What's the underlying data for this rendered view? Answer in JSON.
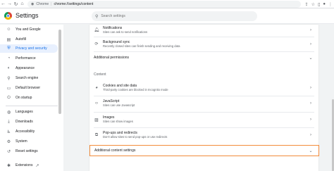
{
  "browser": {
    "back_icon": "arrow-left-icon",
    "url_scheme": "Chrome",
    "url": "chrome://settings/content"
  },
  "header": {
    "title": "Settings",
    "search_placeholder": "Search settings"
  },
  "sidebar": {
    "items": [
      {
        "label": "You and Google",
        "icon": "person-icon",
        "active": false
      },
      {
        "label": "Autofill",
        "icon": "clipboard-icon",
        "active": false
      },
      {
        "label": "Privacy and security",
        "icon": "shield-icon",
        "active": true
      },
      {
        "label": "Performance",
        "icon": "speedometer-icon",
        "active": false
      },
      {
        "label": "Appearance",
        "icon": "palette-icon",
        "active": false
      },
      {
        "label": "Search engine",
        "icon": "search-icon",
        "active": false
      },
      {
        "label": "Default browser",
        "icon": "browser-icon",
        "active": false
      },
      {
        "label": "On startup",
        "icon": "power-icon",
        "active": false
      },
      {
        "label": "Languages",
        "icon": "globe-icon",
        "active": false
      },
      {
        "label": "Downloads",
        "icon": "download-icon",
        "active": false
      },
      {
        "label": "Accessibility",
        "icon": "accessibility-icon",
        "active": false
      },
      {
        "label": "System",
        "icon": "wrench-icon",
        "active": false
      },
      {
        "label": "Reset settings",
        "icon": "reset-icon",
        "active": false
      },
      {
        "label": "Extensions",
        "icon": "puzzle-icon",
        "active": false
      }
    ]
  },
  "content": {
    "rows_top": [
      {
        "title": "Notifications",
        "subtitle": "Sites can ask to send notifications",
        "icon": "bell-icon"
      },
      {
        "title": "Background sync",
        "subtitle": "Recently closed sites can finish sending and receiving data",
        "icon": "sync-icon"
      }
    ],
    "additional_permissions": "Additional permissions",
    "section_content": "Content",
    "rows_content": [
      {
        "title": "Cookies and site data",
        "subtitle": "Third-party cookies are blocked in Incognito mode",
        "icon": "cookie-icon"
      },
      {
        "title": "JavaScript",
        "subtitle": "Sites can use Javascript",
        "icon": "code-icon"
      },
      {
        "title": "Images",
        "subtitle": "Sites can show images",
        "icon": "image-icon"
      },
      {
        "title": "Pop-ups and redirects",
        "subtitle": "Don't allow sites to send pop-ups or use redirects",
        "icon": "popup-icon"
      }
    ],
    "additional_content_settings": "Additional content settings"
  },
  "colors": {
    "accent": "#1a73e8",
    "highlight_border": "#f28b3b"
  }
}
